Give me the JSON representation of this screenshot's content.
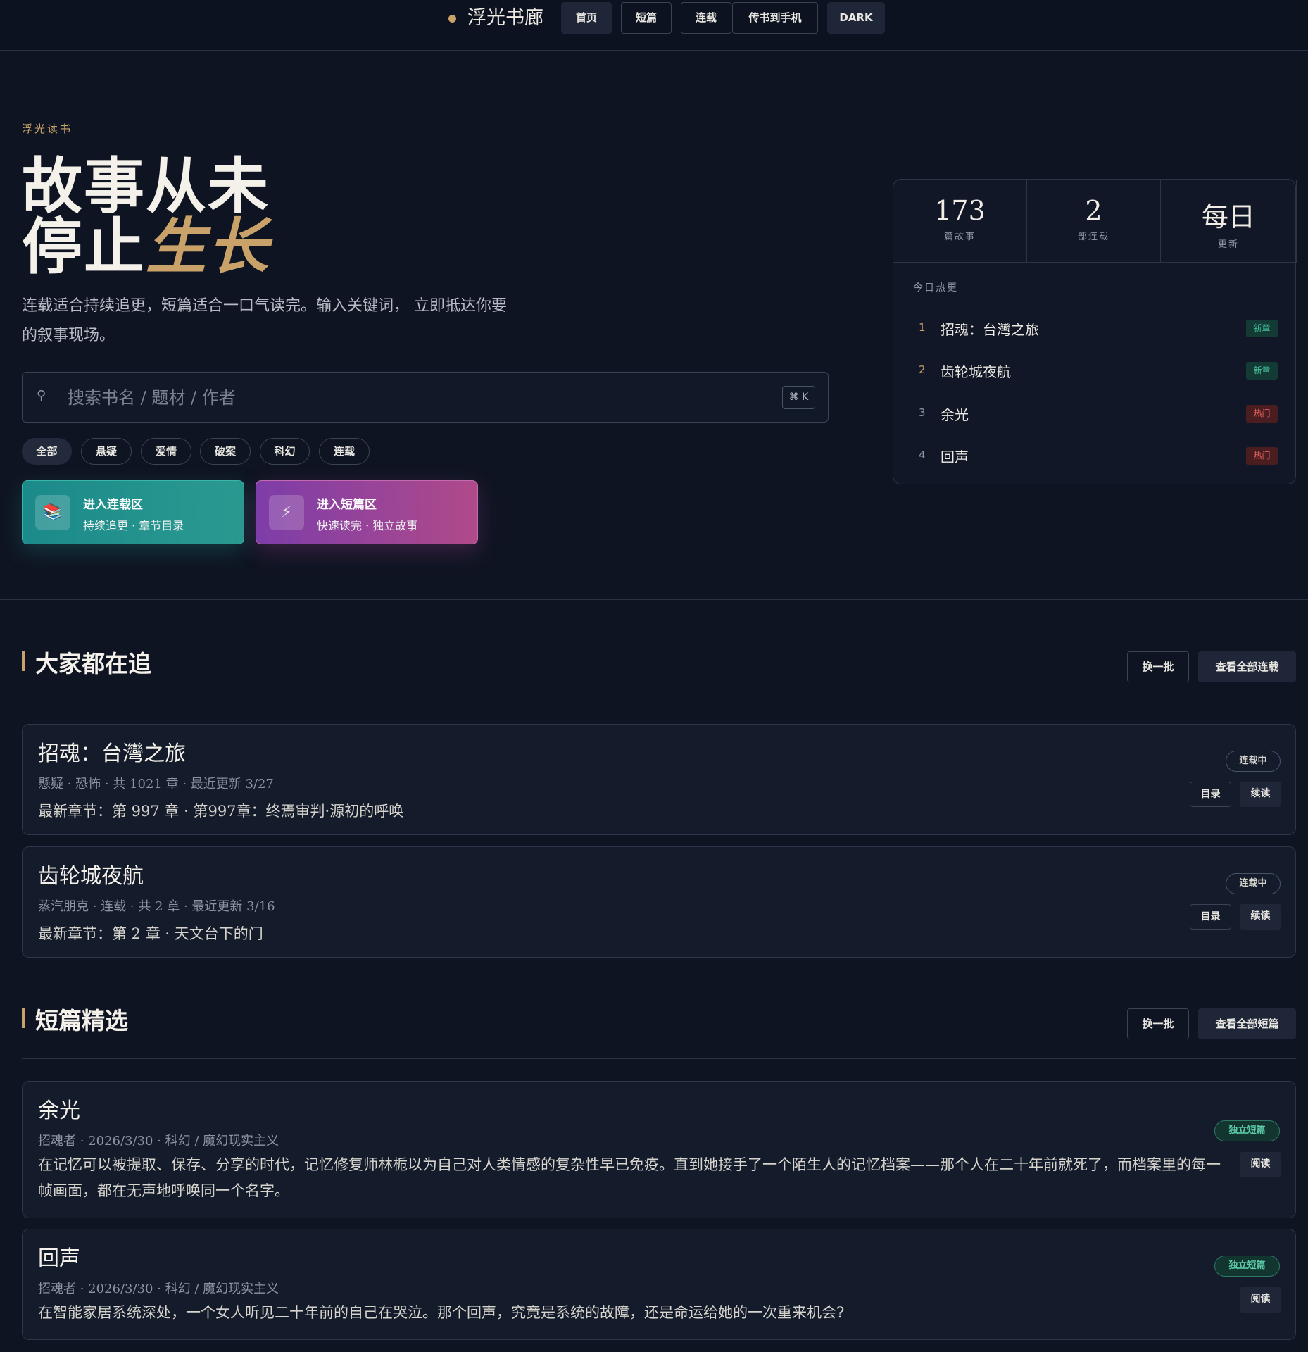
{
  "nav": {
    "brand": "浮光书廊",
    "items": [
      "首页",
      "短篇",
      "连载",
      "传书到手机",
      "DARK"
    ]
  },
  "hero": {
    "eyebrow": "浮光读书",
    "title_line1": "故事从未",
    "title_line2_plain": "停止",
    "title_line2_accent": "生长",
    "subtitle": "连载适合持续追更，短篇适合一口气读完。输入关键词， 立即抵达你要的叙事现场。",
    "search_placeholder": "搜索书名 / 题材 / 作者",
    "search_shortcut": "⌘ K",
    "chips": [
      "全部",
      "悬疑",
      "爱情",
      "破案",
      "科幻",
      "连载"
    ],
    "cta_serial": {
      "title": "进入连载区",
      "subtitle": "持续追更 · 章节目录",
      "icon": "📚"
    },
    "cta_short": {
      "title": "进入短篇区",
      "subtitle": "快速读完 · 独立故事",
      "icon": "⚡"
    }
  },
  "stats": [
    {
      "value": "173",
      "label": "篇故事"
    },
    {
      "value": "2",
      "label": "部连载"
    },
    {
      "value": "每日",
      "label": "更新"
    }
  ],
  "hot": {
    "title": "今日热更",
    "items": [
      {
        "rank": "1",
        "name": "招魂：台灣之旅",
        "tag": "新章"
      },
      {
        "rank": "2",
        "name": "齿轮城夜航",
        "tag": "新章"
      },
      {
        "rank": "3",
        "name": "余光",
        "tag": "热门"
      },
      {
        "rank": "4",
        "name": "回声",
        "tag": "热门"
      }
    ]
  },
  "serials": {
    "title": "大家都在追",
    "refresh": "换一批",
    "view_all": "查看全部连载",
    "items": [
      {
        "title": "招魂：台灣之旅",
        "meta": "懸疑 · 恐怖 · 共 1021 章 · 最近更新 3/27",
        "latest": "最新章节：第 997 章 · 第997章：终焉审判·源初的呼唤",
        "badge": "连载中",
        "toc": "目录",
        "continue": "续读"
      },
      {
        "title": "齿轮城夜航",
        "meta": "蒸汽朋克 · 连载 · 共 2 章 · 最近更新 3/16",
        "latest": "最新章节：第 2 章 · 天文台下的门",
        "badge": "连载中",
        "toc": "目录",
        "continue": "续读"
      }
    ]
  },
  "shorts": {
    "title": "短篇精选",
    "refresh": "换一批",
    "view_all": "查看全部短篇",
    "items": [
      {
        "title": "余光",
        "meta": "招魂者 · 2026/3/30 · 科幻 / 魔幻现实主义",
        "desc": "在记忆可以被提取、保存、分享的时代，记忆修复师林栀以为自己对人类情感的复杂性早已免疫。直到她接手了一个陌生人的记忆档案——那个人在二十年前就死了，而档案里的每一帧画面，都在无声地呼唤同一个名字。",
        "badge": "独立短篇",
        "read": "阅读"
      },
      {
        "title": "回声",
        "meta": "招魂者 · 2026/3/30 · 科幻 / 魔幻现实主义",
        "desc": "在智能家居系统深处，一个女人听见二十年前的自己在哭泣。那个回声，究竟是系统的故障，还是命运给她的一次重来机会?",
        "badge": "独立短篇",
        "read": "阅读"
      }
    ]
  },
  "colors": {
    "accent": "#c9a26a",
    "background": "#0f1422",
    "new_tag": "#46c5a0",
    "hot_tag": "#e06060"
  }
}
